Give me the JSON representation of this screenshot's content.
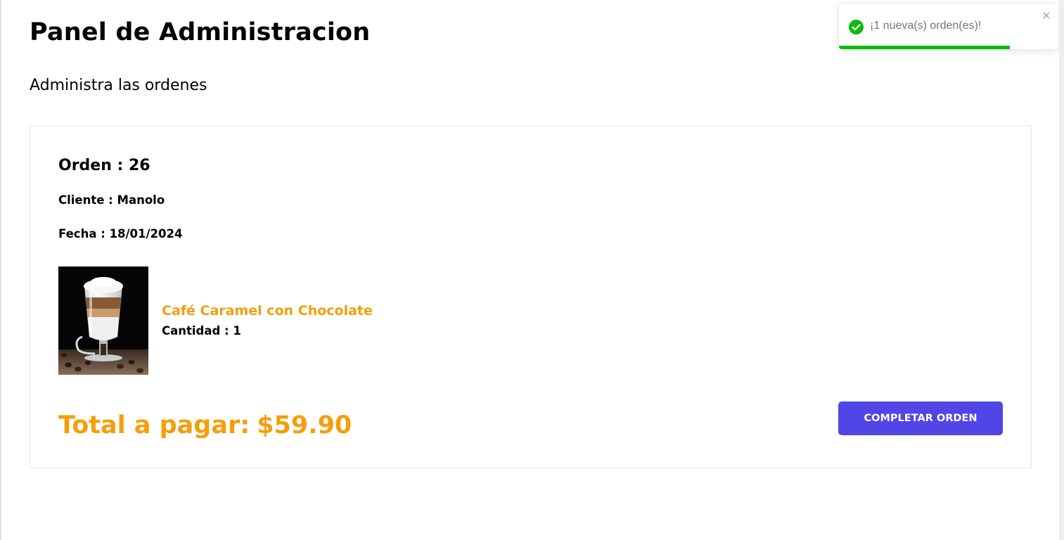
{
  "header": {
    "title": "Panel de Administracion",
    "subtitle": "Administra las ordenes"
  },
  "order": {
    "number_text": "Orden : 26",
    "client_text": "Cliente : Manolo",
    "date_text": "Fecha : 18/01/2024",
    "products": [
      {
        "name": "Café Caramel con Chocolate",
        "quantity_text": "Cantidad : 1"
      }
    ],
    "total_label": "Total a pagar:",
    "total_value": "$59.90",
    "complete_button_label": "Completar Orden"
  },
  "toast": {
    "message": "¡1 nueva(s) orden(es)!",
    "icon": "check-circle-icon",
    "close_glyph": "×",
    "progress_fraction": 0.78,
    "status_color": "#07bc0c"
  },
  "colors": {
    "accent": "#f59e0b",
    "button": "#4f46e5"
  }
}
